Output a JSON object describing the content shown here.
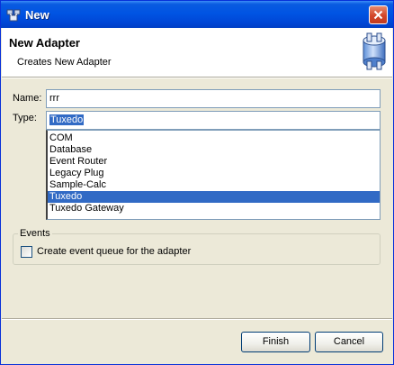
{
  "window": {
    "title": "New",
    "app_icon": "network-computers-icon",
    "close_icon": "close-icon"
  },
  "header": {
    "title": "New Adapter",
    "subtitle": "Creates New Adapter",
    "icon": "adapter-icon"
  },
  "form": {
    "name_label": "Name:",
    "name_value": "rrr",
    "type_label": "Type:",
    "type_value": "Tuxedo"
  },
  "type_list": {
    "items": [
      "COM",
      "Database",
      "Event Router",
      "Legacy Plug",
      "Sample-Calc",
      "Tuxedo",
      "Tuxedo Gateway"
    ],
    "selected": "Tuxedo"
  },
  "events": {
    "legend": "Events",
    "checkbox_label": "Create event queue for the adapter",
    "checked": false
  },
  "buttons": {
    "finish": "Finish",
    "cancel": "Cancel"
  },
  "colors": {
    "selection": "#316ac5",
    "titlebar": "#0054e3",
    "dialog_bg": "#ece9d8"
  }
}
